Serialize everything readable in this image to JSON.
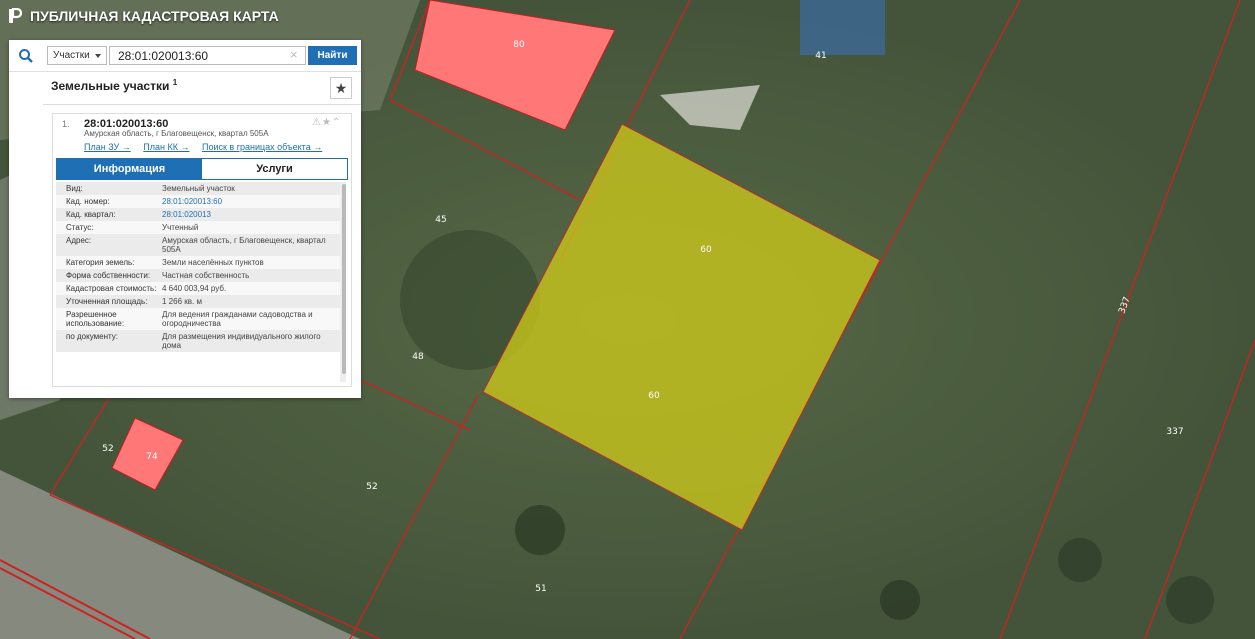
{
  "header": {
    "title": "ПУБЛИЧНАЯ КАДАСТРОВАЯ КАРТА"
  },
  "search": {
    "type_label": "Участки",
    "query": "28:01:020013:60",
    "button": "Найти"
  },
  "results": {
    "title": "Земельные участки",
    "count": "1"
  },
  "result": {
    "index": "1.",
    "number": "28:01:020013:60",
    "address": "Амурская область, г Благовещенск, квартал 505А",
    "links": [
      "План ЗУ →",
      "План КК →",
      "Поиск в границах объекта →"
    ]
  },
  "tabs": [
    "Информация",
    "Услуги"
  ],
  "info": [
    {
      "k": "Вид:",
      "v": "Земельный участок"
    },
    {
      "k": "Кад. номер:",
      "v": "28:01:020013:60",
      "link": true
    },
    {
      "k": "Кад. квартал:",
      "v": "28:01:020013",
      "link": true
    },
    {
      "k": "Статус:",
      "v": "Учтенный"
    },
    {
      "k": "Адрес:",
      "v": "Амурская область, г Благовещенск, квартал 505А"
    },
    {
      "k": "Категория земель:",
      "v": "Земли населённых пунктов"
    },
    {
      "k": "Форма собственности:",
      "v": "Частная собственность"
    },
    {
      "k": "Кадастровая стоимость:",
      "v": "4 640 003,94 руб."
    },
    {
      "k": "Уточненная площадь:",
      "v": "1 266 кв. м"
    },
    {
      "k": "Разрешенное использование:",
      "v": "Для ведения гражданами садоводства и огородничества"
    },
    {
      "k": "по документу:",
      "v": "Для размещения индивидуального жилого дома"
    }
  ],
  "map_labels": [
    "80",
    "41",
    "45",
    "60",
    "60",
    "48",
    "337",
    "337",
    "52",
    "74",
    "52",
    "51"
  ],
  "colors": {
    "accent": "#1f6fb5",
    "selected_parcel": "#c8c41c",
    "building": "#ff7777",
    "boundary": "#d02020"
  }
}
